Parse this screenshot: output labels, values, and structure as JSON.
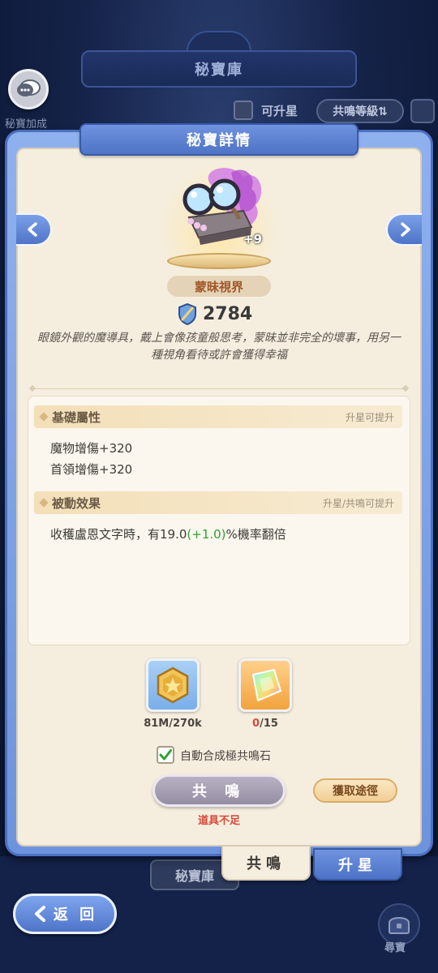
{
  "background": {
    "header_title": "秘寶庫",
    "chat_label": "秘寶加成",
    "filter_label": "可升星",
    "sort_label": "共鳴等級⇅",
    "vault_tab": "秘寶庫"
  },
  "dialog": {
    "title": "秘寶詳情",
    "item": {
      "name": "蒙昧視界",
      "level": "+9",
      "power": "2784",
      "description": "眼鏡外觀的魔導具，戴上會像孩童般思考，蒙昧並非完全的壞事，用另一種視角看待或許會獲得幸福"
    },
    "base_attributes": {
      "title": "基礎屬性",
      "note": "升星可提升",
      "lines": [
        "魔物增傷+320",
        "首領增傷+320"
      ]
    },
    "passive_effect": {
      "title": "被動效果",
      "note": "升星/共鳴可提升",
      "prefix": "收穫盧恩文字時，有19.0",
      "bonus": "(+1.0)",
      "suffix": "%機率翻倍"
    },
    "resources": [
      {
        "name": "gold-coin",
        "count": "81M/270k"
      },
      {
        "name": "resonance-crystal",
        "count_have": "0",
        "count_need": "/15"
      }
    ],
    "auto_merge_label": "自動合成極共鳴石",
    "auto_merge_checked": true,
    "resonate_button": "共 鳴",
    "obtain_button": "獲取途徑",
    "shortage_text": "道具不足",
    "tabs": {
      "resonate": "共鳴",
      "star_up": "升星"
    }
  },
  "footer": {
    "back_label": "返 回",
    "treasure_label": "尋寶"
  },
  "colors": {
    "panel_blue": "#6d93de",
    "parchment": "#f5eedf",
    "green_bonus": "#2fa233",
    "red_warning": "#d64a3a",
    "name_brown": "#a0582a"
  }
}
